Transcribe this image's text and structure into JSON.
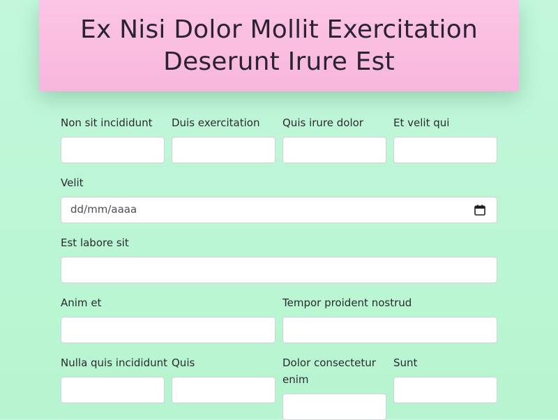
{
  "page": {
    "title": "Ex Nisi Dolor Mollit Exercitation Deserunt Irure Est"
  },
  "form": {
    "row1": [
      {
        "label": "Non sit incididunt",
        "value": ""
      },
      {
        "label": "Duis exercitation",
        "value": ""
      },
      {
        "label": "Quis irure dolor",
        "value": ""
      },
      {
        "label": "Et velit qui",
        "value": ""
      }
    ],
    "row2": {
      "label": "Velit",
      "placeholder": "dd/mm/aaaa",
      "icon": "calendar-icon"
    },
    "row3": {
      "label": "Est labore sit",
      "value": ""
    },
    "row4": [
      {
        "label": "Anim et",
        "value": ""
      },
      {
        "label": "Tempor proident nostrud",
        "value": ""
      }
    ],
    "row5": [
      {
        "label": "Nulla quis incididunt",
        "value": ""
      },
      {
        "label": "Quis",
        "value": ""
      },
      {
        "label": "Dolor consectetur enim",
        "value": ""
      },
      {
        "label": "Sunt",
        "value": ""
      }
    ]
  },
  "colors": {
    "background": "#bdf6d5",
    "header": "#f9bde0",
    "text": "#26262e"
  }
}
